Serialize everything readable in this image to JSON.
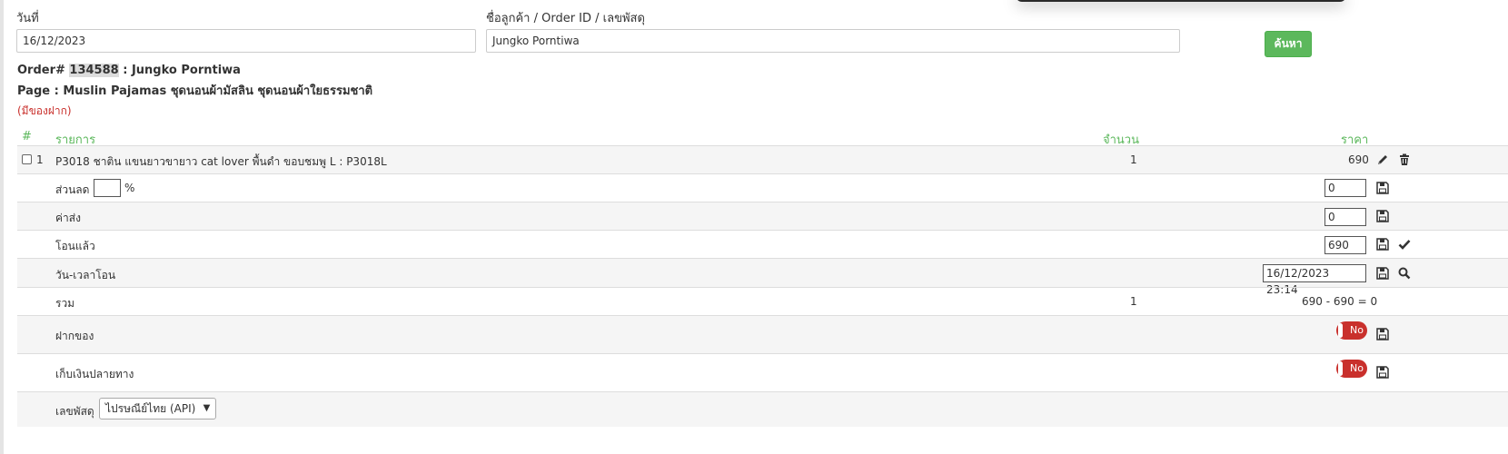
{
  "search": {
    "date_label": "วันที่",
    "date_value": "16/12/2023",
    "customer_label": "ชื่อลูกค้า / Order ID / เลขพัสดุ",
    "customer_value": "Jungko Porntiwa",
    "search_button": "ค้นหา"
  },
  "order": {
    "prefix": "Order# ",
    "id": "134588",
    "customer_sep": " : Jungko Porntiwa",
    "page_line": "Page : Muslin Pajamas ชุดนอนผ้ามัสลิน ชุดนอนผ้าใยธรรมชาติ",
    "note": "(มีของฝาก)"
  },
  "table": {
    "headers": {
      "num": "#",
      "item": "รายการ",
      "qty": "จำนวน",
      "price": "ราคา"
    },
    "item": {
      "num": "1",
      "name": "P3018 ชาติน แขนยาวขายาว cat lover พื้นดำ ขอบชมพู L : P3018L",
      "qty": "1",
      "price": "690"
    },
    "discount": {
      "label": "ส่วนลด",
      "percent_value": "",
      "percent_sign": "%",
      "value": "0"
    },
    "shipping": {
      "label": "ค่าส่ง",
      "value": "0"
    },
    "paid": {
      "label": "โอนแล้ว",
      "value": "690"
    },
    "transfer_time": {
      "label": "วัน-เวลาโอน",
      "value": "16/12/2023 23:14"
    },
    "total": {
      "label": "รวม",
      "qty": "1",
      "value": "690 - 690 = 0"
    },
    "deposit": {
      "label": "ฝากของ",
      "toggle": "No"
    },
    "cod": {
      "label": "เก็บเงินปลายทาง",
      "toggle": "No"
    },
    "tracking": {
      "label": "เลขพัสดุ",
      "carrier": "ไปรษณีย์ไทย (API)"
    }
  },
  "colors": {
    "accent_green": "#5cb85c",
    "danger_red": "#c9302c"
  },
  "icons": [
    "pencil-icon",
    "trash-icon",
    "save-icon",
    "check-icon",
    "search-icon",
    "caret-down-icon"
  ]
}
